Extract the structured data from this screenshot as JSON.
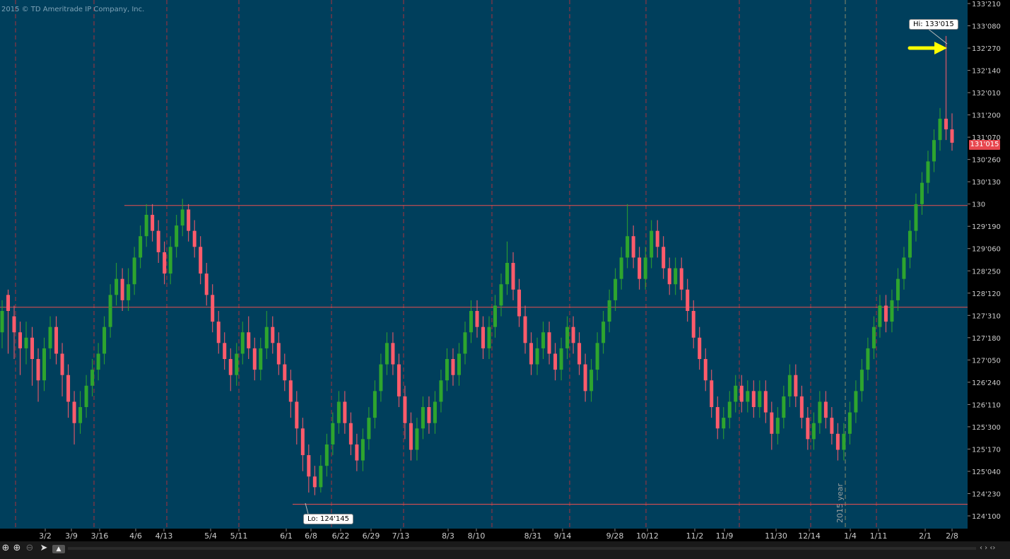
{
  "header": {
    "copyright": "2015 © TD Ameritrade IP Company, Inc."
  },
  "colors": {
    "background": "#003f5c",
    "up": "#2ea52e",
    "down": "#ff5b6b",
    "hline": "#e85050",
    "vgrid": "#a8323c",
    "arrow": "#ffff00"
  },
  "annotations": {
    "hi": "Hi: 133'015",
    "lo": "Lo: 124'145",
    "last_price": "131'015",
    "year_marker": "2015 year"
  },
  "toolbar": {
    "crosshair_icon": "crosshair-icon",
    "zoom_in_icon": "zoom-in-icon",
    "zoom_out_icon": "zoom-out-icon",
    "pointer_icon": "pointer-icon",
    "drawing_icon": "drawing-tool-icon"
  },
  "chart_data": {
    "type": "candlestick",
    "title": "",
    "x_tick_labels": [
      "3/2",
      "3/9",
      "3/16",
      "4/6",
      "4/13",
      "5/4",
      "5/11",
      "6/1",
      "6/8",
      "6/22",
      "6/29",
      "7/13",
      "8/3",
      "8/10",
      "8/31",
      "9/14",
      "9/28",
      "10/12",
      "11/2",
      "11/9",
      "11/30",
      "12/14",
      "1/4",
      "1/11",
      "2/1",
      "2/8"
    ],
    "y_tick_labels": [
      "133'210",
      "133'080",
      "132'270",
      "132'140",
      "132'010",
      "131'200",
      "131'070",
      "130'260",
      "130'130",
      "130",
      "129'190",
      "129'060",
      "128'250",
      "128'120",
      "127'310",
      "127'180",
      "127'050",
      "126'240",
      "126'110",
      "125'300",
      "125'170",
      "125'040",
      "124'230",
      "124'100"
    ],
    "y_range": [
      124.0625,
      133.6563
    ],
    "horizontal_lines": [
      129.875,
      127.96875,
      124.2813
    ],
    "high": 133.0469,
    "low": 124.4531,
    "last": 131.0469,
    "series": [
      {
        "values": [
          [
            127.5,
            127.9,
            127.2,
            128.1
          ],
          [
            128.2,
            127.9,
            127.1,
            128.3
          ],
          [
            127.8,
            127.5,
            127.0,
            128.0
          ],
          [
            127.5,
            127.2,
            126.7,
            127.7
          ],
          [
            127.2,
            127.4,
            126.9,
            127.7
          ],
          [
            127.4,
            127.0,
            126.5,
            127.6
          ],
          [
            127.0,
            126.6,
            126.2,
            127.2
          ],
          [
            126.6,
            127.2,
            126.4,
            127.4
          ],
          [
            127.2,
            127.6,
            127.0,
            127.8
          ],
          [
            127.6,
            127.1,
            126.9,
            127.8
          ],
          [
            127.1,
            126.7,
            126.3,
            127.3
          ],
          [
            126.7,
            126.2,
            125.9,
            126.9
          ],
          [
            126.2,
            125.8,
            125.4,
            126.4
          ],
          [
            125.8,
            126.1,
            125.6,
            126.4
          ],
          [
            126.1,
            126.5,
            125.9,
            126.7
          ],
          [
            126.5,
            126.8,
            126.3,
            127.0
          ],
          [
            126.8,
            127.1,
            126.6,
            127.3
          ],
          [
            127.1,
            127.6,
            126.9,
            127.8
          ],
          [
            127.6,
            128.2,
            127.4,
            128.4
          ],
          [
            128.2,
            128.5,
            128.0,
            128.8
          ],
          [
            128.5,
            128.1,
            127.9,
            128.7
          ],
          [
            128.1,
            128.4,
            127.9,
            128.7
          ],
          [
            128.4,
            128.9,
            128.2,
            129.1
          ],
          [
            128.9,
            129.3,
            128.7,
            129.5
          ],
          [
            129.3,
            129.7,
            129.1,
            129.9
          ],
          [
            129.7,
            129.4,
            129.2,
            129.9
          ],
          [
            129.4,
            129.0,
            128.8,
            129.6
          ],
          [
            129.0,
            128.6,
            128.4,
            129.2
          ],
          [
            128.6,
            129.1,
            128.4,
            129.3
          ],
          [
            129.1,
            129.5,
            128.9,
            129.7
          ],
          [
            129.5,
            129.8,
            129.3,
            130.0
          ],
          [
            129.8,
            129.4,
            129.2,
            129.9
          ],
          [
            129.4,
            129.1,
            128.9,
            129.6
          ],
          [
            129.1,
            128.6,
            128.4,
            129.3
          ],
          [
            128.6,
            128.2,
            128.0,
            128.8
          ],
          [
            128.2,
            127.7,
            127.5,
            128.4
          ],
          [
            127.7,
            127.3,
            127.1,
            127.9
          ],
          [
            127.3,
            127.0,
            126.8,
            127.5
          ],
          [
            127.0,
            126.7,
            126.4,
            127.2
          ],
          [
            126.7,
            127.1,
            126.5,
            127.3
          ],
          [
            127.1,
            127.5,
            126.9,
            127.7
          ],
          [
            127.5,
            127.2,
            127.0,
            127.8
          ],
          [
            127.2,
            126.8,
            126.6,
            127.4
          ],
          [
            126.8,
            127.2,
            126.6,
            127.4
          ],
          [
            127.2,
            127.6,
            127.0,
            127.9
          ],
          [
            127.6,
            127.3,
            127.1,
            127.8
          ],
          [
            127.3,
            126.9,
            126.7,
            127.5
          ],
          [
            126.9,
            126.6,
            126.4,
            127.1
          ],
          [
            126.6,
            126.2,
            125.9,
            126.8
          ],
          [
            126.2,
            125.7,
            125.4,
            126.4
          ],
          [
            125.7,
            125.2,
            124.9,
            125.9
          ],
          [
            125.2,
            124.8,
            124.5,
            125.4
          ],
          [
            124.8,
            124.6,
            124.45,
            125.0
          ],
          [
            124.6,
            125.0,
            124.5,
            125.2
          ],
          [
            125.0,
            125.4,
            124.8,
            125.6
          ],
          [
            125.4,
            125.8,
            125.2,
            126.0
          ],
          [
            125.8,
            126.2,
            125.6,
            126.4
          ],
          [
            126.2,
            125.8,
            125.6,
            126.4
          ],
          [
            125.8,
            125.4,
            125.2,
            126.0
          ],
          [
            125.4,
            125.1,
            124.9,
            125.6
          ],
          [
            125.1,
            125.5,
            124.9,
            125.7
          ],
          [
            125.5,
            125.9,
            125.3,
            126.1
          ],
          [
            125.9,
            126.4,
            125.7,
            126.6
          ],
          [
            126.4,
            126.9,
            126.2,
            127.1
          ],
          [
            126.9,
            127.3,
            126.7,
            127.5
          ],
          [
            127.3,
            126.9,
            126.7,
            127.5
          ],
          [
            126.9,
            126.3,
            126.1,
            127.1
          ],
          [
            126.3,
            125.8,
            125.5,
            126.5
          ],
          [
            125.8,
            125.3,
            125.1,
            126.0
          ],
          [
            125.3,
            125.7,
            125.1,
            125.9
          ],
          [
            125.7,
            126.1,
            125.5,
            126.3
          ],
          [
            126.1,
            125.8,
            125.6,
            126.3
          ],
          [
            125.8,
            126.2,
            125.6,
            126.4
          ],
          [
            126.2,
            126.6,
            126.0,
            126.8
          ],
          [
            126.6,
            127.0,
            126.4,
            127.2
          ],
          [
            127.0,
            126.7,
            126.5,
            127.2
          ],
          [
            126.7,
            127.1,
            126.5,
            127.3
          ],
          [
            127.1,
            127.5,
            126.9,
            127.7
          ],
          [
            127.5,
            127.9,
            127.3,
            128.1
          ],
          [
            127.9,
            127.6,
            127.4,
            128.1
          ],
          [
            127.6,
            127.2,
            127.0,
            127.8
          ],
          [
            127.2,
            127.6,
            127.0,
            127.8
          ],
          [
            127.6,
            128.0,
            127.4,
            128.2
          ],
          [
            128.0,
            128.4,
            127.8,
            128.6
          ],
          [
            128.4,
            128.8,
            128.2,
            129.2
          ],
          [
            128.8,
            128.3,
            128.1,
            129.0
          ],
          [
            128.3,
            127.8,
            127.6,
            128.5
          ],
          [
            127.8,
            127.3,
            127.1,
            128.0
          ],
          [
            127.3,
            126.9,
            126.7,
            127.5
          ],
          [
            126.9,
            127.2,
            126.7,
            127.4
          ],
          [
            127.2,
            127.5,
            127.0,
            127.7
          ],
          [
            127.5,
            127.1,
            126.9,
            127.7
          ],
          [
            127.1,
            126.8,
            126.6,
            127.3
          ],
          [
            126.8,
            127.2,
            126.6,
            127.4
          ],
          [
            127.2,
            127.6,
            127.0,
            127.8
          ],
          [
            127.6,
            127.3,
            127.1,
            127.8
          ],
          [
            127.3,
            126.9,
            126.7,
            127.5
          ],
          [
            126.9,
            126.4,
            126.2,
            127.1
          ],
          [
            126.4,
            126.8,
            126.2,
            127.0
          ],
          [
            126.8,
            127.3,
            126.6,
            127.5
          ],
          [
            127.3,
            127.7,
            127.1,
            127.9
          ],
          [
            127.7,
            128.1,
            127.5,
            128.3
          ],
          [
            128.1,
            128.5,
            127.9,
            128.7
          ],
          [
            128.5,
            128.9,
            128.3,
            129.1
          ],
          [
            128.9,
            129.3,
            128.7,
            129.9
          ],
          [
            129.3,
            128.9,
            128.7,
            129.5
          ],
          [
            128.9,
            128.5,
            128.3,
            129.1
          ],
          [
            128.5,
            128.9,
            128.3,
            129.1
          ],
          [
            128.9,
            129.4,
            128.7,
            129.6
          ],
          [
            129.4,
            129.1,
            128.9,
            129.6
          ],
          [
            129.1,
            128.7,
            128.5,
            129.3
          ],
          [
            128.7,
            128.4,
            128.2,
            128.9
          ],
          [
            128.4,
            128.7,
            128.2,
            128.9
          ],
          [
            128.7,
            128.3,
            128.1,
            128.9
          ],
          [
            128.3,
            127.9,
            127.7,
            128.5
          ],
          [
            127.9,
            127.4,
            127.2,
            128.1
          ],
          [
            127.4,
            127.0,
            126.8,
            127.6
          ],
          [
            127.0,
            126.6,
            126.4,
            127.2
          ],
          [
            126.6,
            126.1,
            125.9,
            126.8
          ],
          [
            126.1,
            125.7,
            125.5,
            126.3
          ],
          [
            125.7,
            125.9,
            125.5,
            126.1
          ],
          [
            125.9,
            126.2,
            125.7,
            126.4
          ],
          [
            126.2,
            126.5,
            126.0,
            126.7
          ],
          [
            126.5,
            126.2,
            126.0,
            126.7
          ],
          [
            126.2,
            126.4,
            126.0,
            126.6
          ],
          [
            126.4,
            126.1,
            125.9,
            126.6
          ],
          [
            126.1,
            126.4,
            125.9,
            126.6
          ],
          [
            126.4,
            126.0,
            125.8,
            126.6
          ],
          [
            126.0,
            125.6,
            125.3,
            126.2
          ],
          [
            125.6,
            125.9,
            125.4,
            126.1
          ],
          [
            125.9,
            126.3,
            125.7,
            126.5
          ],
          [
            126.3,
            126.7,
            126.1,
            126.9
          ],
          [
            126.7,
            126.3,
            126.1,
            126.9
          ],
          [
            126.3,
            125.9,
            125.7,
            126.5
          ],
          [
            125.9,
            125.5,
            125.3,
            126.1
          ],
          [
            125.5,
            125.8,
            125.3,
            126.0
          ],
          [
            125.8,
            126.2,
            125.6,
            126.4
          ],
          [
            126.2,
            125.9,
            125.7,
            126.4
          ],
          [
            125.9,
            125.6,
            125.4,
            126.1
          ],
          [
            125.6,
            125.3,
            125.1,
            125.8
          ],
          [
            125.3,
            125.6,
            125.1,
            125.8
          ],
          [
            125.6,
            126.0,
            125.4,
            126.2
          ],
          [
            126.0,
            126.4,
            125.8,
            126.6
          ],
          [
            126.4,
            126.8,
            126.2,
            127.0
          ],
          [
            126.8,
            127.2,
            126.6,
            127.4
          ],
          [
            127.2,
            127.6,
            127.0,
            127.8
          ],
          [
            127.6,
            128.0,
            127.4,
            128.2
          ],
          [
            128.0,
            127.7,
            127.5,
            128.2
          ],
          [
            127.7,
            128.1,
            127.5,
            128.3
          ],
          [
            128.1,
            128.5,
            127.9,
            128.7
          ],
          [
            128.5,
            128.9,
            128.3,
            129.1
          ],
          [
            128.9,
            129.4,
            128.7,
            129.6
          ],
          [
            129.4,
            129.9,
            129.2,
            130.1
          ],
          [
            129.9,
            130.3,
            129.7,
            130.5
          ],
          [
            130.3,
            130.7,
            130.1,
            130.9
          ],
          [
            130.7,
            131.1,
            130.5,
            131.3
          ],
          [
            131.1,
            131.5,
            130.9,
            131.7
          ],
          [
            131.5,
            131.3,
            131.1,
            133.05
          ],
          [
            131.3,
            131.05,
            130.9,
            131.6
          ]
        ]
      }
    ]
  }
}
